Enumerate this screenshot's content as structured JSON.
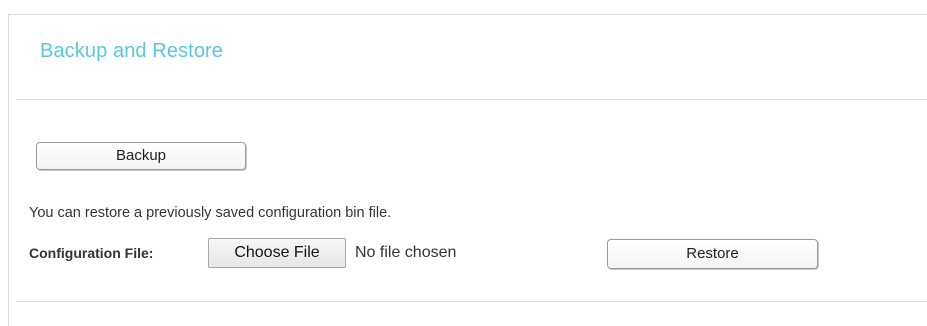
{
  "section": {
    "title": "Backup and Restore"
  },
  "backup": {
    "button_label": "Backup"
  },
  "restore": {
    "info_text": "You can restore a previously saved configuration bin file.",
    "config_file_label": "Configuration File:",
    "choose_file_label": "Choose File",
    "file_status": "No file chosen",
    "button_label": "Restore"
  },
  "colors": {
    "title": "#5ac8d8",
    "divider": "#dcdcdc"
  }
}
